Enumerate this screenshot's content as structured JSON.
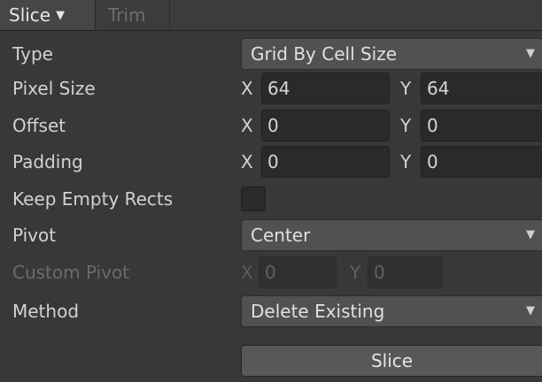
{
  "toolbar": {
    "slice_tab": "Slice",
    "slice_caret": "▼",
    "trim_tab": "Trim"
  },
  "type": {
    "label": "Type",
    "value": "Grid By Cell Size",
    "arrow": "▼"
  },
  "pixel_size": {
    "label": "Pixel Size",
    "x_label": "X",
    "x_value": "64",
    "y_label": "Y",
    "y_value": "64"
  },
  "offset": {
    "label": "Offset",
    "x_label": "X",
    "x_value": "0",
    "y_label": "Y",
    "y_value": "0"
  },
  "padding": {
    "label": "Padding",
    "x_label": "X",
    "x_value": "0",
    "y_label": "Y",
    "y_value": "0"
  },
  "keep_empty_rects": {
    "label": "Keep Empty Rects",
    "checked": false
  },
  "pivot": {
    "label": "Pivot",
    "value": "Center",
    "arrow": "▼"
  },
  "custom_pivot": {
    "label": "Custom Pivot",
    "x_label": "X",
    "x_value": "0",
    "y_label": "Y",
    "y_value": "0"
  },
  "method": {
    "label": "Method",
    "value": "Delete Existing",
    "arrow": "▼"
  },
  "slice_button": {
    "label": "Slice"
  }
}
